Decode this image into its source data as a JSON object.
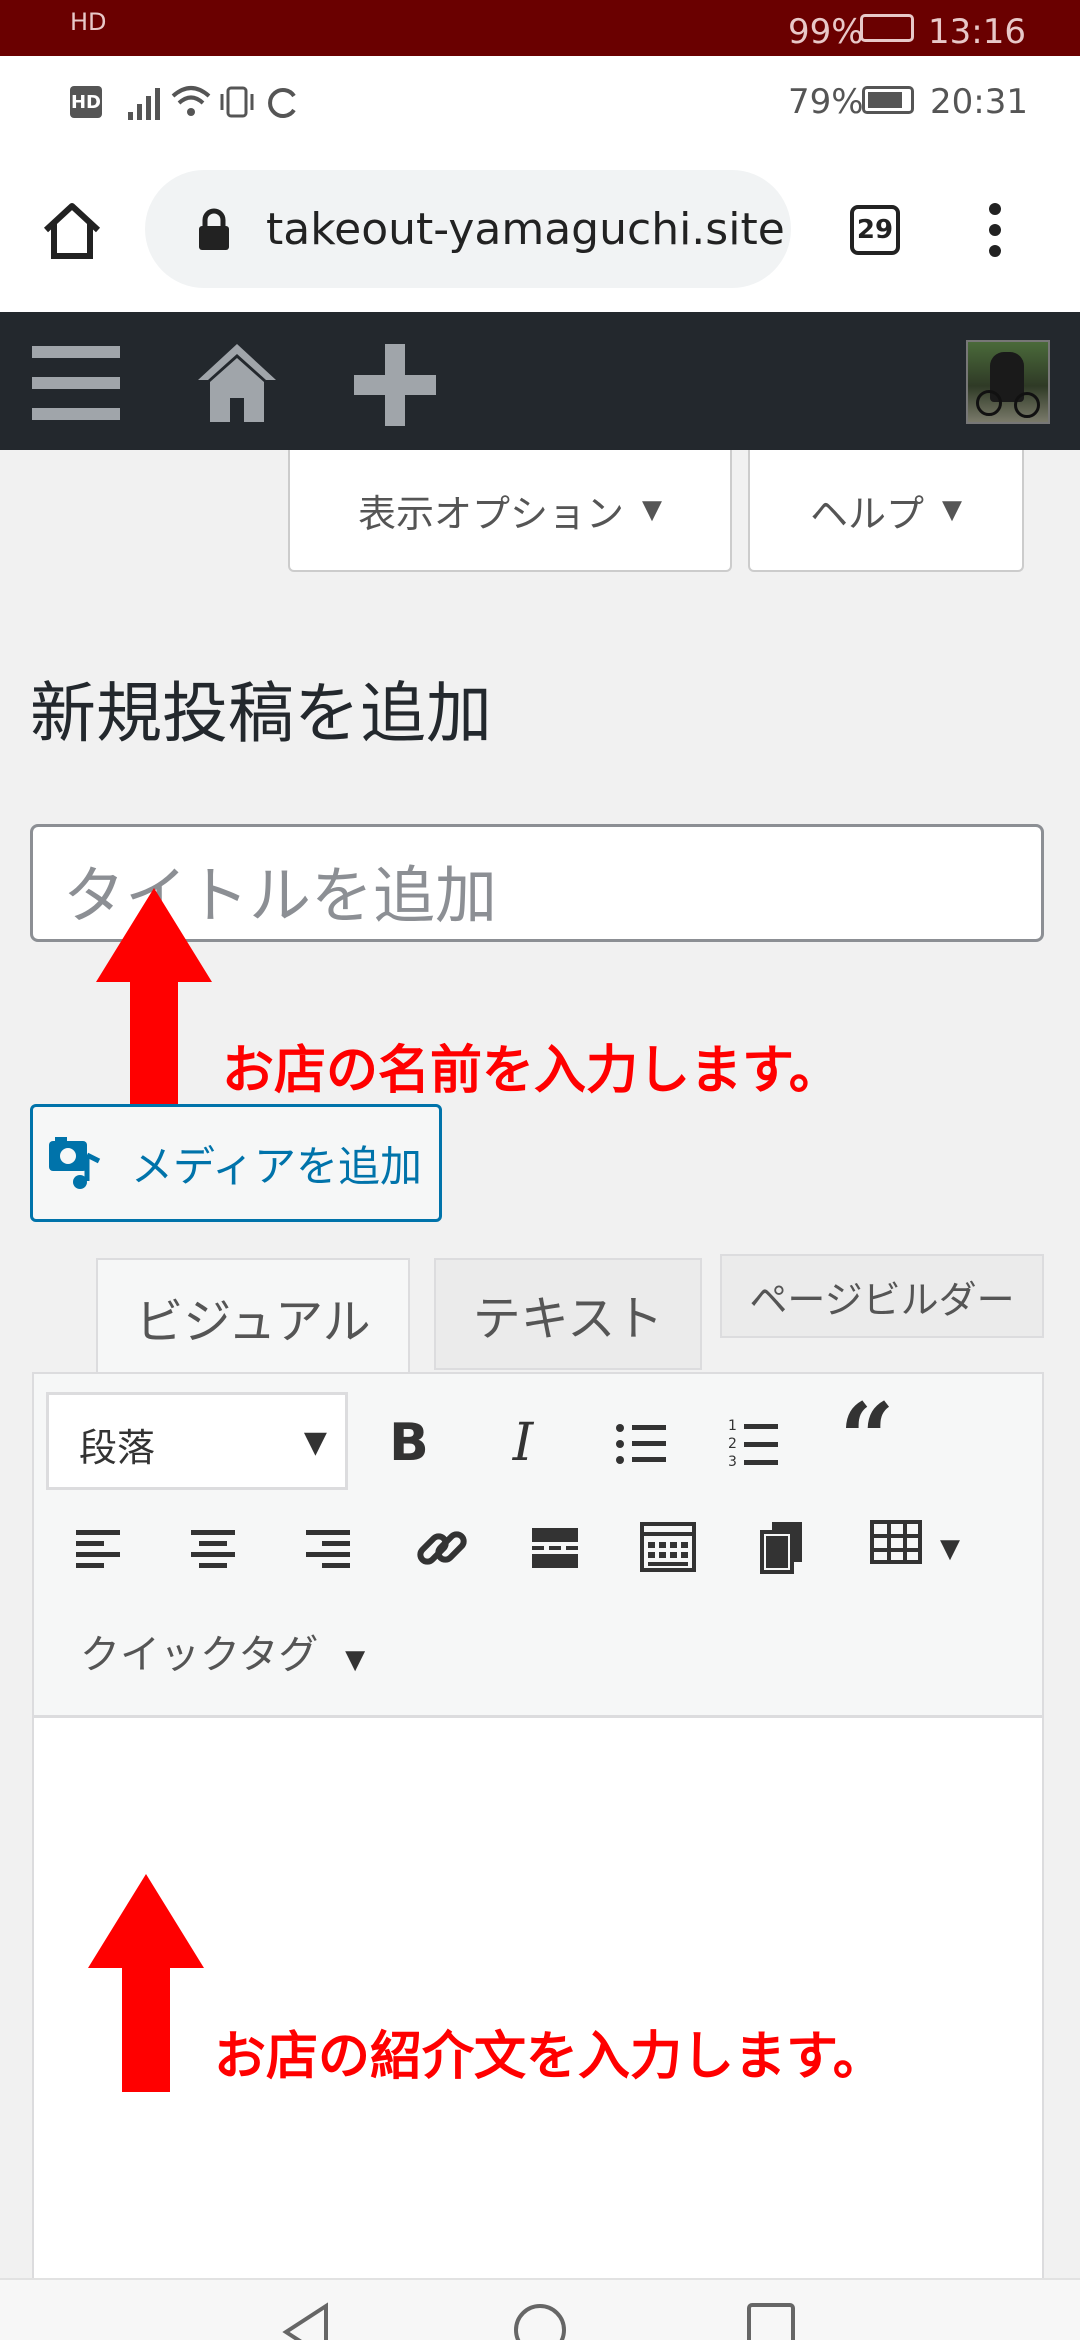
{
  "ghost_status": {
    "time": "13:16",
    "battery": "99%"
  },
  "status_bar": {
    "hd": "HD",
    "battery": "79%",
    "time": "20:31"
  },
  "browser": {
    "url": "takeout-yamaguchi.site",
    "tab_count": "29"
  },
  "admin_bar": {
    "icons": [
      "menu-icon",
      "home-icon",
      "plus-icon"
    ]
  },
  "screen_options": {
    "options_label": "表示オプション",
    "help_label": "ヘルプ"
  },
  "page": {
    "heading": "新規投稿を追加",
    "title_placeholder": "タイトルを追加"
  },
  "media_button": {
    "label": "メディアを追加"
  },
  "editor_tabs": {
    "visual": "ビジュアル",
    "text": "テキスト",
    "page_builder": "ページビルダー"
  },
  "toolbar": {
    "format_select": "段落",
    "row1": [
      "bold-icon",
      "italic-icon",
      "bullet-list-icon",
      "numbered-list-icon",
      "blockquote-icon"
    ],
    "row2": [
      "align-left-icon",
      "align-center-icon",
      "align-right-icon",
      "link-icon",
      "read-more-icon",
      "toolbar-toggle-icon",
      "paste-icon",
      "table-icon"
    ],
    "bold": "B",
    "italic": "I",
    "quote": "“",
    "quicktag": "クイックタグ"
  },
  "annotations": {
    "title_note": "お店の名前を入力します。",
    "content_note": "お店の紹介文を入力します。"
  },
  "colors": {
    "admin_bar": "#23282d",
    "annotation_red": "#ff0000",
    "media_blue": "#0073aa"
  }
}
